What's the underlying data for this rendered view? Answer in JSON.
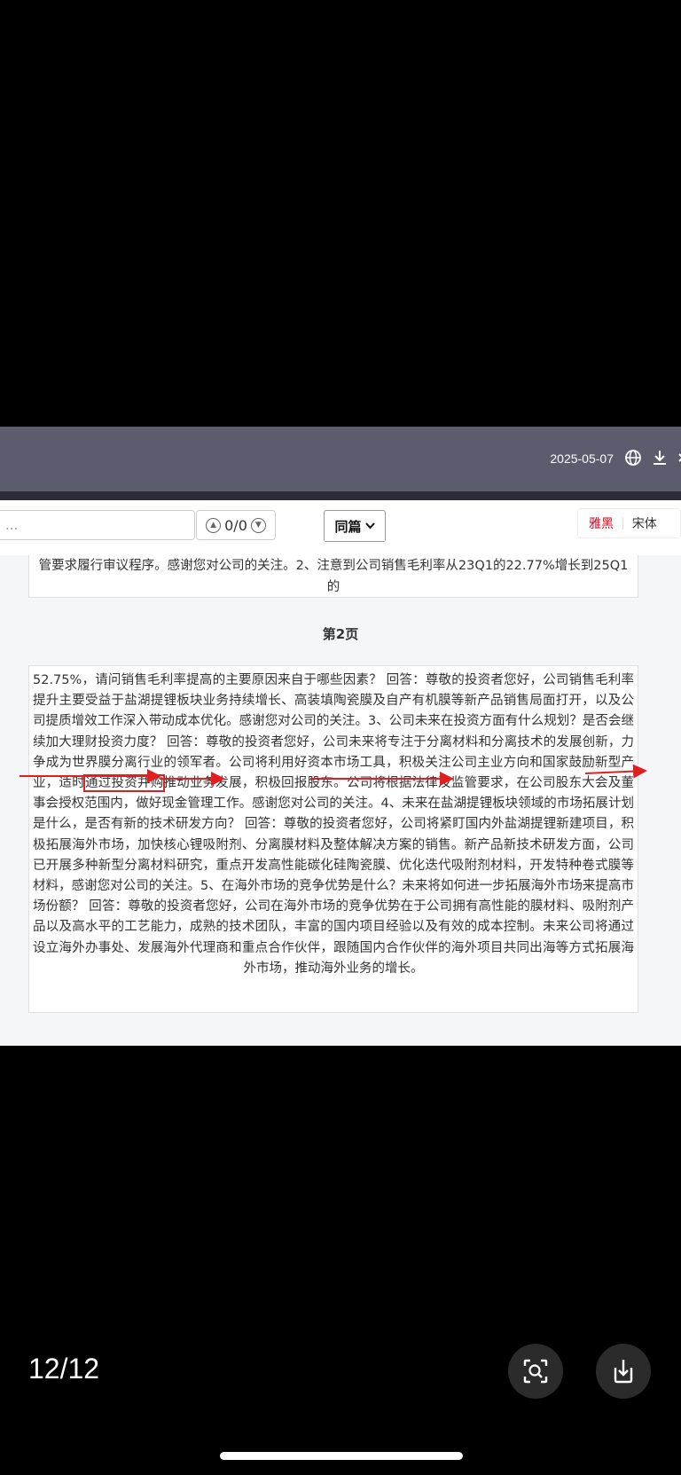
{
  "viewer": {
    "page_counter": "12/12",
    "buttons": {
      "scan": "scan-text",
      "download": "download"
    }
  },
  "doc_header": {
    "date": "2025-05-07"
  },
  "toolbar": {
    "search_placeholder": "...",
    "match_counter": "0/0",
    "scope_select": "同篇",
    "font_options": [
      "雅黑",
      "宋体"
    ],
    "active_font": "雅黑"
  },
  "document": {
    "upper_cell_text": "管要求履行审议程序。感谢您对公司的关注。2、注意到公司销售毛利率从23Q1的22.77%增长到25Q1的",
    "page_label": "第2页",
    "lower_cell": {
      "before_highlight": "52.75%，请问销售毛利率提高的主要原因来自于哪些因素？ 回答：尊敬的投资者您好，公司销售毛利率提升主要受益于盐湖提锂板块业务持续增长、高装填陶瓷膜及自产有机膜等新产品销售局面打开，以及公司提质增效工作深入带动成本优化。感谢您对公司的关注。3、公司未来在投资方面有什么规划？是否会继续加大理财投资力度？ 回答：尊敬的投资者您好，公司未来将专注于分离材料和分离技术的发展创新，力争成为世界膜分离行业的领军者。公司将利用好资本市场工具，积极关注公司主业方向和国家鼓励新型产业，适时",
      "highlight": "通过投资并购",
      "after_highlight": "推动业务发展，积极回报股东。公司将根据法律及监管要求，在公司股东大会及董事会授权范围内，做好现金管理工作。感谢您对公司的关注。4、未来在盐湖提锂板块领域的市场拓展计划是什么，是否有新的技术研发方向？ 回答：尊敬的投资者您好，公司将紧盯国内外盐湖提锂新建项目，积极拓展海外市场，加快核心锂吸附剂、分离膜材料及整体解决方案的销售。新产品新技术研发方面，公司已开展多种新型分离材料研究，重点开发高性能碳化硅陶瓷膜、优化迭代吸附剂材料，开发特种卷式膜等材料，感谢您对公司的关注。5、在海外市场的竞争优势是什么？未来将如何进一步拓展海外市场来提高市场份额？ 回答：尊敬的投资者您好，公司在海外市场的竞争优势在于公司拥有高性能的膜材料、吸附剂产品以及高水平的工艺能力，成熟的技术团队，丰富的国内项目经验以及有效的成本控制。未来公司将通过设立海外办事处、发展海外代理商和重点合作伙伴，跟随国内合作伙伴的海外项目共同出海等方式拓展海外市场，推动海外业务的增长。"
    }
  },
  "colors": {
    "header_bg": "#5b5c6e",
    "annotation_red": "#e02020",
    "font_active": "#d0021b"
  }
}
